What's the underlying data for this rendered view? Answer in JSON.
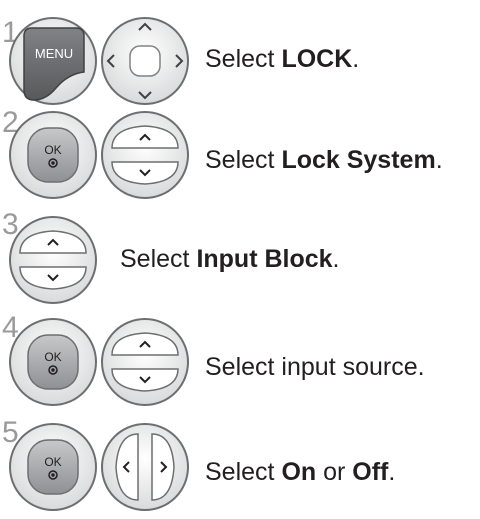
{
  "steps": [
    {
      "number": "1",
      "buttons": {
        "menu_label": "MENU"
      },
      "instruction": {
        "prefix": "Select ",
        "bold": "LOCK",
        "suffix": "."
      }
    },
    {
      "number": "2",
      "buttons": {
        "ok_label": "OK"
      },
      "instruction": {
        "prefix": "Select ",
        "bold": "Lock System",
        "suffix": "."
      }
    },
    {
      "number": "3",
      "buttons": {},
      "instruction": {
        "prefix": "Select ",
        "bold": "Input Block",
        "suffix": "."
      }
    },
    {
      "number": "4",
      "buttons": {
        "ok_label": "OK"
      },
      "instruction": {
        "text": "Select input source."
      }
    },
    {
      "number": "5",
      "buttons": {
        "ok_label": "OK"
      },
      "instruction": {
        "prefix": "Select ",
        "bold1": "On",
        "mid": " or ",
        "bold2": "Off",
        "suffix": "."
      }
    }
  ],
  "colors": {
    "step_number": "#9a9a9a",
    "button_fill": "#d9d9d9",
    "menu_fill": "#6d6e70"
  }
}
